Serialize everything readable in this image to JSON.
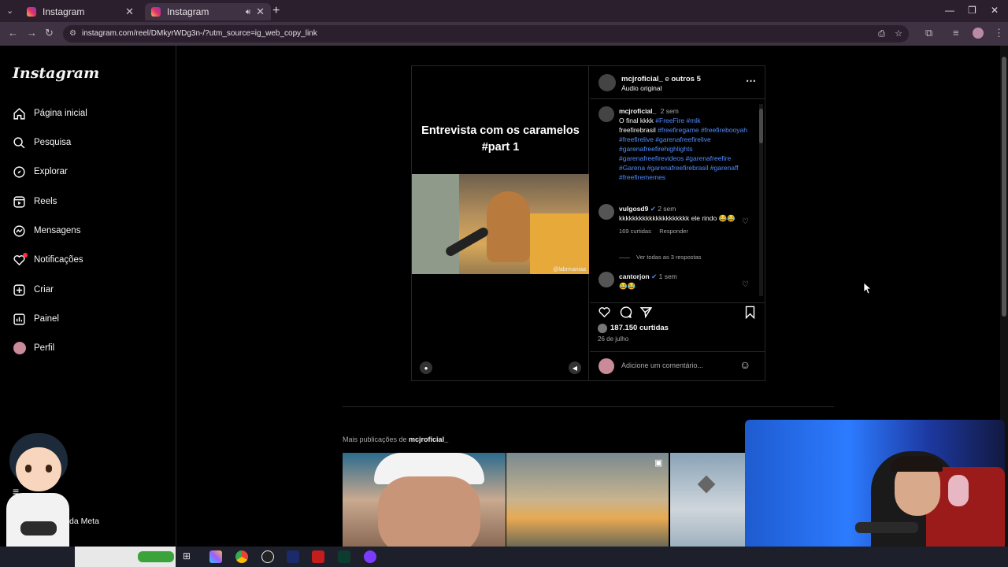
{
  "browser": {
    "tabs": [
      {
        "title": "Instagram",
        "active": false
      },
      {
        "title": "Instagram",
        "active": true
      }
    ],
    "url": "instagram.com/reel/DMkyrWDg3n-/?utm_source=ig_web_copy_link"
  },
  "sidebar": {
    "logo": "Instagram",
    "items": [
      {
        "label": "Página inicial",
        "icon": "home-icon"
      },
      {
        "label": "Pesquisa",
        "icon": "search-icon"
      },
      {
        "label": "Explorar",
        "icon": "compass-icon"
      },
      {
        "label": "Reels",
        "icon": "reels-icon"
      },
      {
        "label": "Mensagens",
        "icon": "messenger-icon"
      },
      {
        "label": "Notificações",
        "icon": "heart-icon"
      },
      {
        "label": "Criar",
        "icon": "plus-icon"
      },
      {
        "label": "Painel",
        "icon": "chart-icon"
      },
      {
        "label": "Perfil",
        "icon": "avatar-icon"
      }
    ],
    "meta_label": "da Meta"
  },
  "post": {
    "media_title": "Entrevista com  os caramelos #part 1",
    "watermark": "@labrmaniaa",
    "header": {
      "username": "mcjroficial_",
      "suffix": " e ",
      "others": "outros 5",
      "audio": "Áudio original"
    },
    "caption": {
      "username": "mcjroficial_",
      "time": "2 sem",
      "text_a": "O final kkkk ",
      "tags_a": "#FreeFire #mlk",
      "text_b": "freefirebrasil ",
      "tags_b": "#freefiregame #freefirebooyah #freefirelive #garenafreefirelive #garenafreefirehighlights #garenafreefirevideos #garenafreefire #Garena #garenafreefirebrasil #garenaff #freefirememes"
    },
    "comments": [
      {
        "username": "vulgosd9",
        "time": "2 sem",
        "text": "kkkkkkkkkkkkkkkkkkkkk ele rindo 😂😂",
        "likes": "169 curtidas",
        "reply": "Responder",
        "replies": "Ver todas as 3 respostas"
      },
      {
        "username": "cantorjon",
        "time": "1 sem",
        "text": "😂😂"
      }
    ],
    "likes": "187.150 curtidas",
    "date": "26 de julho",
    "comment_placeholder": "Adicione um comentário..."
  },
  "more": {
    "label": "Mais publicações de ",
    "user": "mcjroficial_"
  }
}
